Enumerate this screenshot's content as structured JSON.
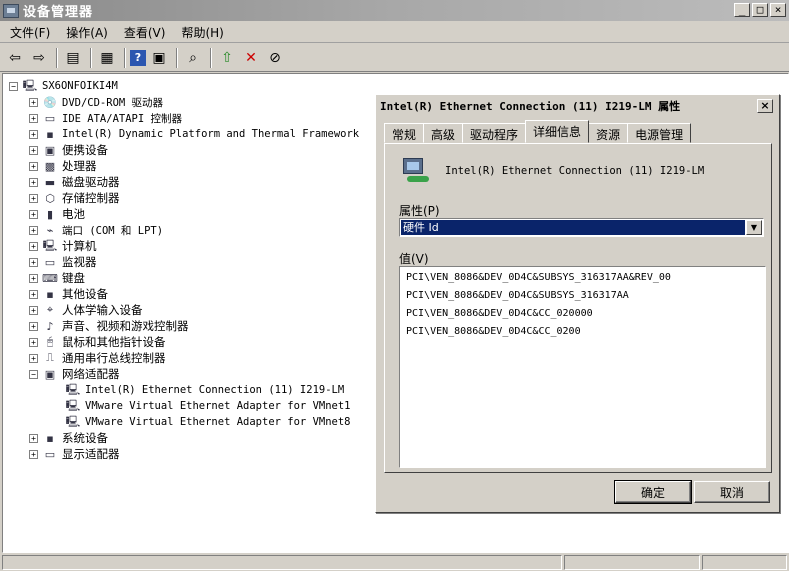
{
  "window": {
    "title": "设备管理器",
    "min": "_",
    "max": "□",
    "close": "×"
  },
  "menu": [
    "文件(F)",
    "操作(A)",
    "查看(V)",
    "帮助(H)"
  ],
  "tree": {
    "root": "SX6ONFOIKI4M",
    "categories": [
      "DVD/CD-ROM 驱动器",
      "IDE ATA/ATAPI 控制器",
      "Intel(R) Dynamic Platform and Thermal Framework",
      "便携设备",
      "处理器",
      "磁盘驱动器",
      "存储控制器",
      "电池",
      "端口 (COM 和 LPT)",
      "计算机",
      "监视器",
      "键盘",
      "其他设备",
      "人体学输入设备",
      "声音、视频和游戏控制器",
      "鼠标和其他指针设备",
      "通用串行总线控制器",
      "网络适配器"
    ],
    "network_children": [
      "Intel(R) Ethernet Connection (11) I219-LM",
      "VMware Virtual Ethernet Adapter for VMnet1",
      "VMware Virtual Ethernet Adapter for VMnet8"
    ],
    "tail": [
      "系统设备",
      "显示适配器"
    ]
  },
  "dialog": {
    "title": "Intel(R) Ethernet Connection (11) I219-LM 属性",
    "close": "×",
    "tabs": [
      "常规",
      "高级",
      "驱动程序",
      "详细信息",
      "资源",
      "电源管理"
    ],
    "active_tab": 3,
    "device_name": "Intel(R) Ethernet Connection (11) I219-LM",
    "property_label": "属性(P)",
    "property_value": "硬件 Id",
    "value_label": "值(V)",
    "values": [
      "PCI\\VEN_8086&DEV_0D4C&SUBSYS_316317AA&REV_00",
      "PCI\\VEN_8086&DEV_0D4C&SUBSYS_316317AA",
      "PCI\\VEN_8086&DEV_0D4C&CC_020000",
      "PCI\\VEN_8086&DEV_0D4C&CC_0200"
    ],
    "ok": "确定",
    "cancel": "取消"
  }
}
